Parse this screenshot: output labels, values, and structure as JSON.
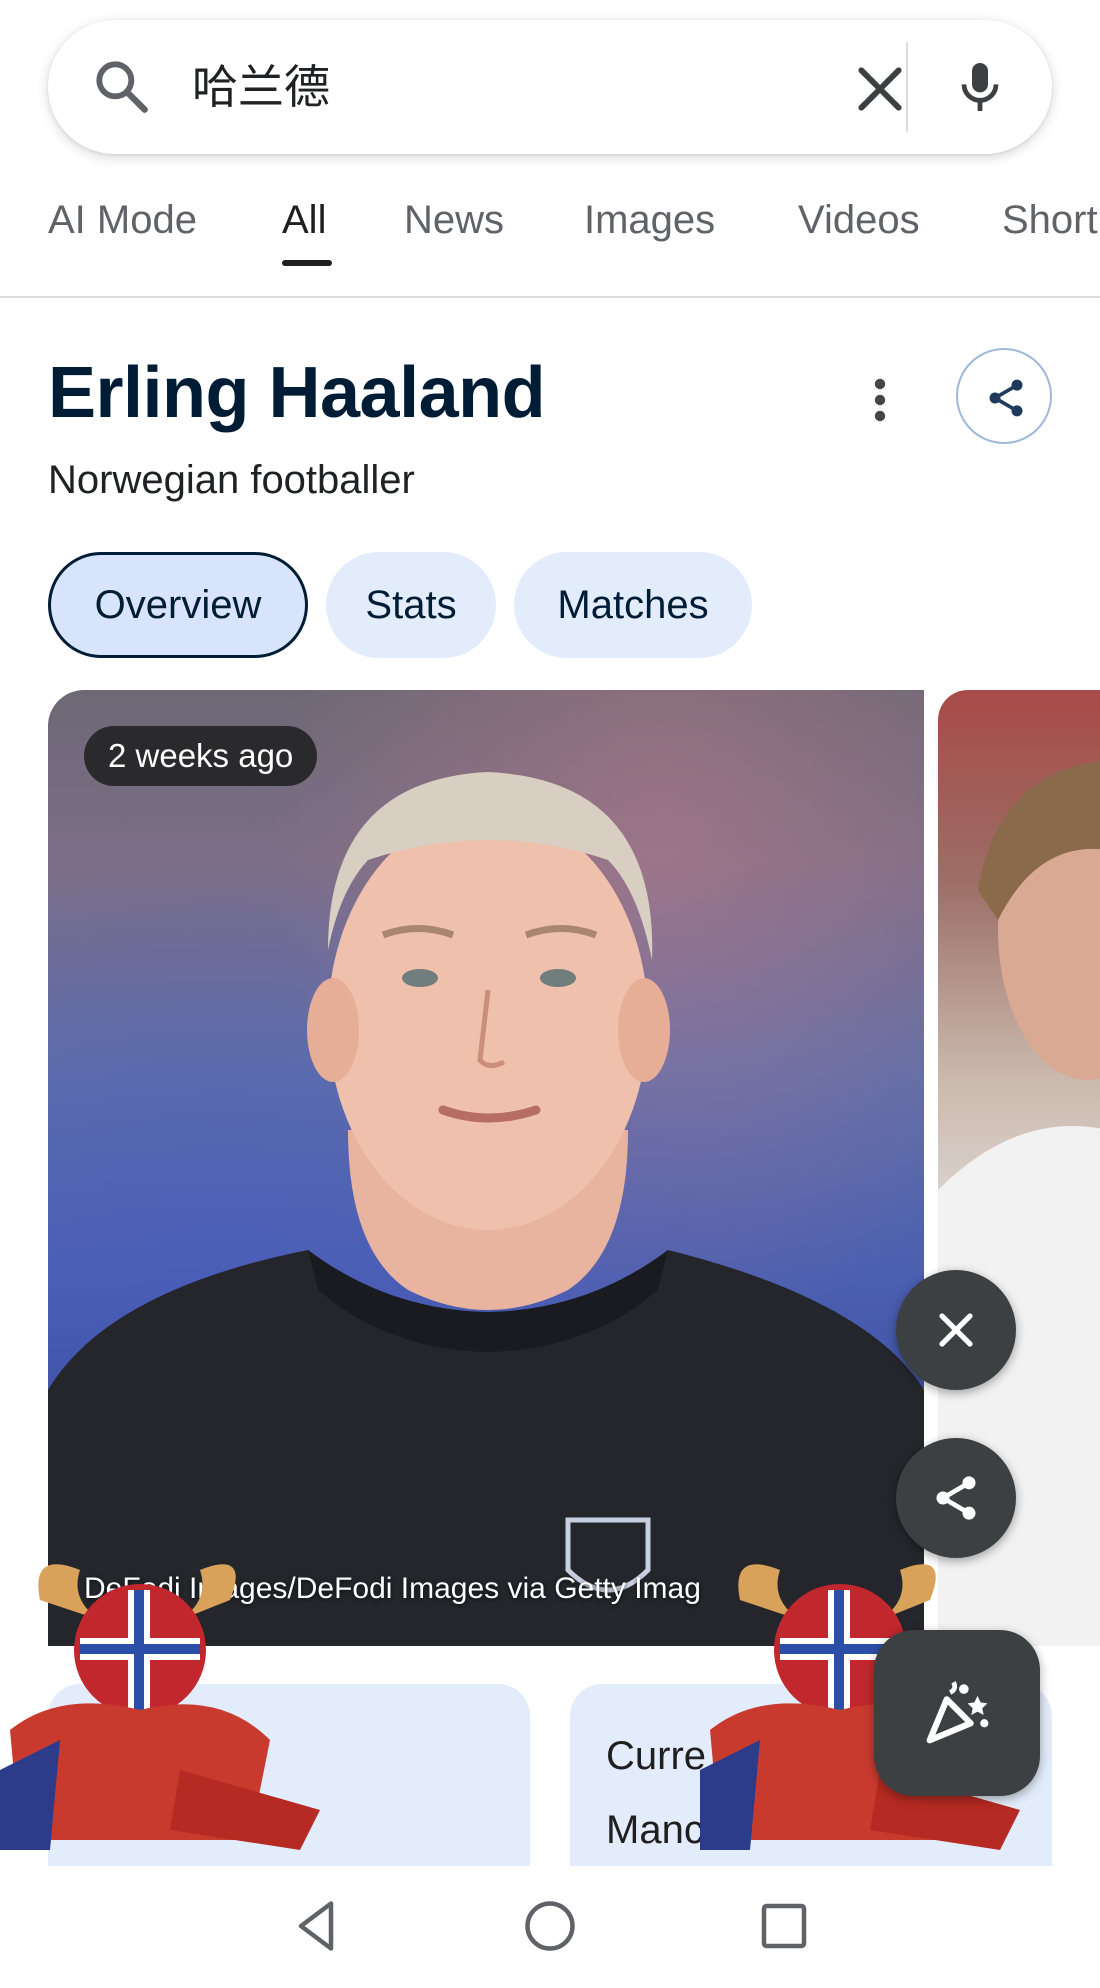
{
  "search": {
    "query": "哈兰德"
  },
  "tabs": [
    {
      "label": "AI Mode"
    },
    {
      "label": "All"
    },
    {
      "label": "News"
    },
    {
      "label": "Images"
    },
    {
      "label": "Videos"
    },
    {
      "label": "Short"
    }
  ],
  "entity": {
    "title": "Erling Haaland",
    "subtitle": "Norwegian footballer"
  },
  "chips": [
    {
      "label": "Overview"
    },
    {
      "label": "Stats"
    },
    {
      "label": "Matches"
    }
  ],
  "image_card": {
    "time_badge": "2 weeks ago",
    "credit": "DeFodi Images/DeFodi Images via Getty Imag"
  },
  "info_cards": [
    {
      "label": "",
      "value": ""
    },
    {
      "label": "Curre",
      "value": "Manc"
    }
  ],
  "icons": {
    "search": "search-icon",
    "clear": "close-icon",
    "mic": "microphone-icon",
    "more": "more-vert-icon",
    "share": "share-icon",
    "close_fab": "close-icon",
    "share_fab": "share-icon",
    "celebrate": "party-popper-icon",
    "nav_back": "back-triangle-icon",
    "nav_home": "home-circle-icon",
    "nav_recents": "recents-square-icon"
  },
  "colors": {
    "title": "#001d35",
    "chip_bg": "#e3ecfb",
    "fab_bg": "#3c4043",
    "card_bg": "#e3ecfb"
  }
}
